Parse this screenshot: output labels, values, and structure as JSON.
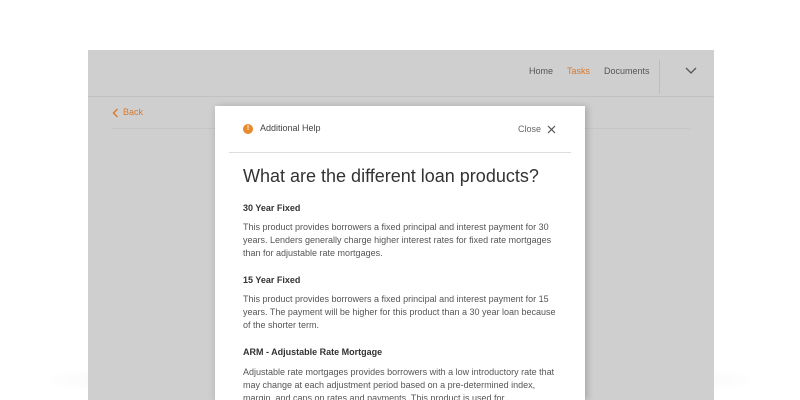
{
  "nav": {
    "items": [
      {
        "label": "Home"
      },
      {
        "label": "Tasks",
        "active": true
      },
      {
        "label": "Documents"
      }
    ],
    "menu_icon": "chevron-down-icon"
  },
  "back": {
    "label": "Back",
    "icon": "chevron-left-icon"
  },
  "modal": {
    "header": {
      "icon": "info-icon",
      "icon_glyph": "!",
      "title": "Additional Help",
      "close_label": "Close",
      "close_icon": "close-icon"
    },
    "heading": "What are the different loan products?",
    "sections": [
      {
        "title": "30 Year Fixed",
        "body": "This product provides borrowers a fixed principal and interest payment for 30 years. Lenders generally charge higher interest rates for fixed rate mortgages than for adjustable rate mortgages."
      },
      {
        "title": "15 Year Fixed",
        "body": "This product provides borrowers a fixed principal and interest payment for 15 years. The payment will be higher for this product than a 30 year loan because of the shorter term."
      },
      {
        "title": "ARM - Adjustable Rate Mortgage",
        "body": "Adjustable rate mortgages provides borrowers with a low introductory rate that may change at each adjustment period based on a pre-determined index, margin, and caps on rates and payments. This product is used for"
      }
    ]
  },
  "colors": {
    "accent": "#d87a2f",
    "help_icon": "#e8892c",
    "overlay": "#cfcfcf",
    "modal_background": "#ffffff"
  }
}
